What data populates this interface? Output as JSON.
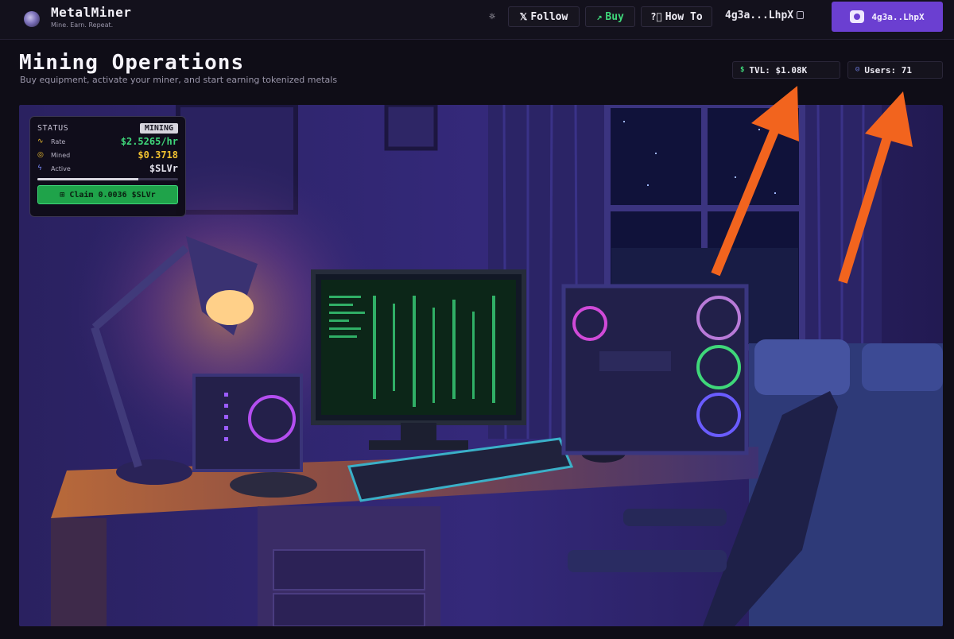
{
  "brand": {
    "name": "MetalMiner",
    "tagline": "Mine. Earn. Repeat."
  },
  "nav": {
    "theme_icon": "sun-icon",
    "follow_label": "Follow",
    "follow_icon": "x-logo-icon",
    "buy_label": "Buy",
    "buy_icon": "external-link-icon",
    "howto_label": "How To",
    "howto_icon": "help-circle-icon",
    "wallet_address": "4g3a...LhpX",
    "wallet_button_label": "4g3a..LhpX"
  },
  "page": {
    "title": "Mining Operations",
    "subtitle": "Buy equipment, activate your miner, and start earning tokenized metals"
  },
  "stats": {
    "tvl_label": "TVL: $1.08K",
    "users_label": "Users: 71"
  },
  "status": {
    "title": "STATUS",
    "badge": "MINING",
    "rate_label": "Rate",
    "rate_value": "$2.5265/hr",
    "mined_label": "Mined",
    "mined_value": "$0.3718",
    "active_label": "Active",
    "active_value": "$SLVr",
    "progress": 0.72,
    "claim_label": "Claim 0.0036 $SLVr"
  },
  "colors": {
    "accent_purple": "#6b3fd1",
    "green": "#3fd77a",
    "yellow": "#f2c230",
    "arrow": "#f2641e",
    "background": "#0f0d17"
  }
}
